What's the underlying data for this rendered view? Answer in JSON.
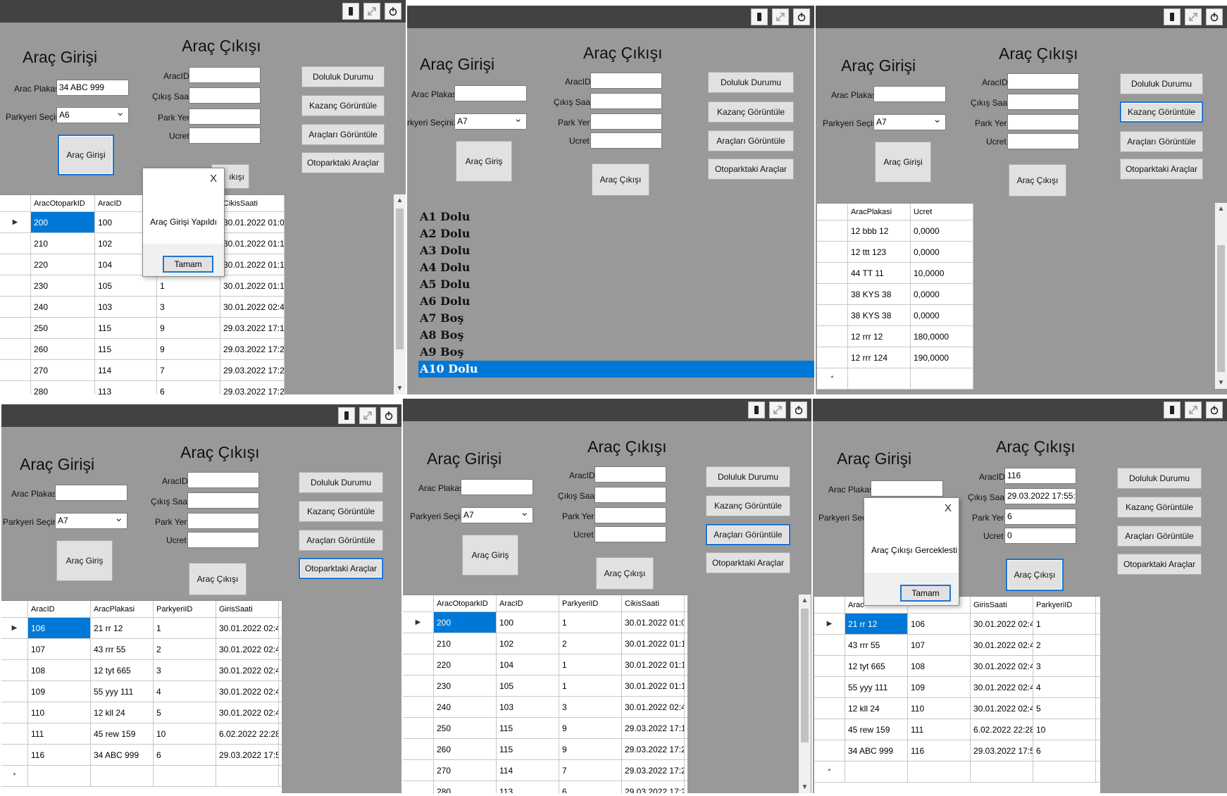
{
  "titles": {
    "entry": "Araç Girişi",
    "exit": "Araç Çıkışı"
  },
  "labels": {
    "plate": "Arac Plakası",
    "parking_select": "Parkyeri Seçiniz",
    "parking_select_cut": "rkyeri Seçiniz",
    "vehicle_id": "AracID",
    "exit_time": "Çıkış Saati",
    "park_place": "Park Yeri",
    "fee": "Ucret"
  },
  "buttons": {
    "entry": "Araç Girişi",
    "entry_alt": "Araç Giriş",
    "exit": "Araç Çıkışı",
    "occupancy": "Doluluk Durumu",
    "earnings": "Kazanç Görüntüle",
    "vehicles": "Araçları Görüntüle",
    "parked": "Otoparktaki Araçlar"
  },
  "panel1": {
    "plate_value": "34 ABC 999",
    "parking_value": "A6",
    "exit_partial": "ıkışı",
    "dialog_message": "Araç Girişi Yapıldı",
    "dialog_ok": "Tamam",
    "dialog_close": "X",
    "columns": [
      "AracOtoparkID",
      "AracID",
      "",
      "CikisSaati"
    ],
    "rows": [
      [
        "200",
        "100",
        "",
        "30.01.2022 01:06"
      ],
      [
        "210",
        "102",
        "",
        "30.01.2022 01:10"
      ],
      [
        "220",
        "104",
        "",
        "30.01.2022 01:16"
      ],
      [
        "230",
        "105",
        "1",
        "30.01.2022 01:17"
      ],
      [
        "240",
        "103",
        "3",
        "30.01.2022 02:44"
      ],
      [
        "250",
        "115",
        "9",
        "29.03.2022 17:10"
      ],
      [
        "260",
        "115",
        "9",
        "29.03.2022 17:21"
      ],
      [
        "270",
        "114",
        "7",
        "29.03.2022 17:21"
      ],
      [
        "280",
        "113",
        "6",
        "29.03.2022 17:28"
      ]
    ]
  },
  "panel2": {
    "parking_value": "A7",
    "list": [
      "A1 Dolu",
      "A2 Dolu",
      "A3 Dolu",
      "A4 Dolu",
      "A5 Dolu",
      "A6 Dolu",
      "A7 Boş",
      "A8 Boş",
      "A9 Boş",
      "A10 Dolu"
    ]
  },
  "panel3": {
    "parking_value": "A7",
    "columns": [
      "AracPlakasi",
      "Ucret"
    ],
    "rows": [
      [
        "12 bbb 12",
        "0,0000"
      ],
      [
        "12 ttt 123",
        "0,0000"
      ],
      [
        "44 TT 11",
        "10,0000"
      ],
      [
        "38 KYS 38",
        "0,0000"
      ],
      [
        "38 KYS 38",
        "0,0000"
      ],
      [
        "12 rrr 12",
        "180,0000"
      ],
      [
        "12 rrr 124",
        "190,0000"
      ]
    ]
  },
  "panel4": {
    "parking_value": "A7",
    "columns": [
      "AracID",
      "AracPlakasi",
      "ParkyeriID",
      "GirisSaati"
    ],
    "rows": [
      [
        "106",
        "21 rr 12",
        "1",
        "30.01.2022 02:44"
      ],
      [
        "107",
        "43 rrr 55",
        "2",
        "30.01.2022 02:44"
      ],
      [
        "108",
        "12 tyt 665",
        "3",
        "30.01.2022 02:44"
      ],
      [
        "109",
        "55 yyy 111",
        "4",
        "30.01.2022 02:45"
      ],
      [
        "110",
        "12 kll 24",
        "5",
        "30.01.2022 02:45"
      ],
      [
        "111",
        "45 rew 159",
        "10",
        "6.02.2022 22:28"
      ],
      [
        "116",
        "34 ABC 999",
        "6",
        "29.03.2022 17:55"
      ]
    ]
  },
  "panel5": {
    "parking_value": "A7",
    "columns": [
      "AracOtoparkID",
      "AracID",
      "ParkyeriID",
      "CikisSaati"
    ],
    "rows": [
      [
        "200",
        "100",
        "1",
        "30.01.2022 01:06"
      ],
      [
        "210",
        "102",
        "2",
        "30.01.2022 01:10"
      ],
      [
        "220",
        "104",
        "1",
        "30.01.2022 01:16"
      ],
      [
        "230",
        "105",
        "1",
        "30.01.2022 01:17"
      ],
      [
        "240",
        "103",
        "3",
        "30.01.2022 02:44"
      ],
      [
        "250",
        "115",
        "9",
        "29.03.2022 17:10"
      ],
      [
        "260",
        "115",
        "9",
        "29.03.2022 17:21"
      ],
      [
        "270",
        "114",
        "7",
        "29.03.2022 17:21"
      ],
      [
        "280",
        "113",
        "6",
        "29.03.2022 17:28"
      ]
    ]
  },
  "panel6": {
    "vehicle_id_value": "116",
    "exit_time_value": "29.03.2022 17:55:05",
    "park_place_value": "6",
    "fee_value": "0",
    "parking_label_cut": "Parkyeri Seçi",
    "dialog_message": "Araç Çıkışı Gerceklesti",
    "dialog_ok": "Tamam",
    "dialog_close": "X",
    "columns": [
      "Arac",
      "",
      "GirisSaati",
      "ParkyeriID"
    ],
    "rows": [
      [
        "21 rr 12",
        "106",
        "30.01.2022 02:44",
        "1"
      ],
      [
        "43 rrr 55",
        "107",
        "30.01.2022 02:44",
        "2"
      ],
      [
        "12 tyt 665",
        "108",
        "30.01.2022 02:44",
        "3"
      ],
      [
        "55 yyy 111",
        "109",
        "30.01.2022 02:45",
        "4"
      ],
      [
        "12 kll 24",
        "110",
        "30.01.2022 02:45",
        "5"
      ],
      [
        "45 rew 159",
        "111",
        "6.02.2022 22:28",
        "10"
      ],
      [
        "34 ABC 999",
        "116",
        "29.03.2022 17:55",
        "6"
      ]
    ]
  },
  "icons": {
    "window_buttons": [
      "minimize-icon",
      "maximize-icon",
      "power-icon"
    ]
  },
  "colors": {
    "titlebar": "#424242",
    "form_bg": "#999999",
    "selection": "#0078d7",
    "focus_border": "#1e74d0"
  }
}
